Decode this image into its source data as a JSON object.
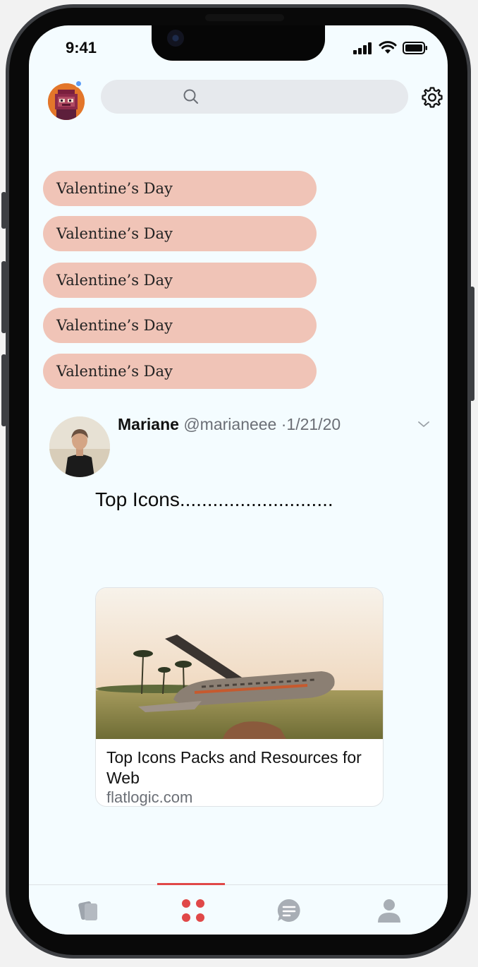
{
  "status_bar": {
    "time": "9:41"
  },
  "header": {
    "search": {
      "placeholder": ""
    }
  },
  "pills": [
    {
      "label": "Valentine’s Day"
    },
    {
      "label": "Valentine’s Day"
    },
    {
      "label": "Valentine’s Day"
    },
    {
      "label": "Valentine’s Day"
    },
    {
      "label": "Valentine’s Day"
    }
  ],
  "post": {
    "author_name": "Mariane",
    "author_handle": "@marianeee",
    "date": "·1/21/20",
    "text": "Top Icons............................",
    "link_card": {
      "title": "Top Icons Packs and Resources for Web",
      "domain": "flatlogic.com"
    }
  },
  "tab_bar": {
    "tabs": [
      {
        "icon": "cards-icon",
        "active": false
      },
      {
        "icon": "grid-dots-icon",
        "active": true
      },
      {
        "icon": "message-icon",
        "active": false
      },
      {
        "icon": "profile-icon",
        "active": false
      }
    ]
  },
  "colors": {
    "accent": "#e04848",
    "pill": "#f0c4b7",
    "notification": "#5b9cf6",
    "background": "#f4fcff"
  }
}
